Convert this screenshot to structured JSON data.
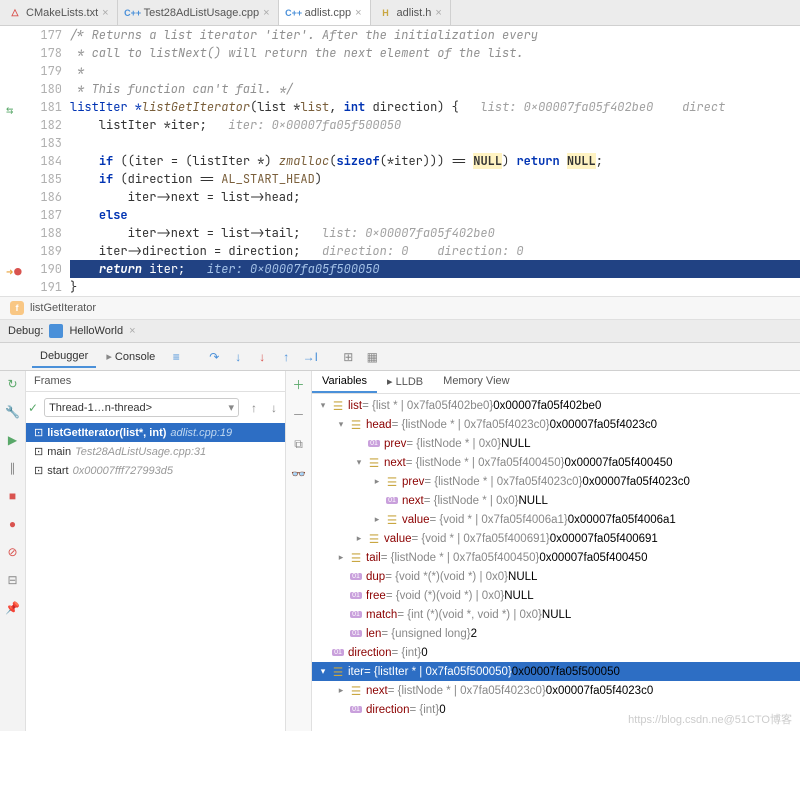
{
  "tabs": [
    {
      "icon": "cmake",
      "label": "CMakeLists.txt",
      "active": false
    },
    {
      "icon": "cpp",
      "label": "Test28AdListUsage.cpp",
      "active": false
    },
    {
      "icon": "cpp",
      "label": "adlist.cpp",
      "active": true
    },
    {
      "icon": "h",
      "label": "adlist.h",
      "active": false
    }
  ],
  "lines": [
    {
      "n": "177",
      "html": "/* Returns a list iterator 'iter'. After the initialization every",
      "cls": "cm"
    },
    {
      "n": "178",
      "html": " * call to listNext() will return the next element of the list.",
      "cls": "cm"
    },
    {
      "n": "179",
      "html": " *",
      "cls": "cm"
    },
    {
      "n": "180",
      "html": " * This function can't fail. */",
      "cls": "cm"
    },
    {
      "n": "181"
    },
    {
      "n": "182"
    },
    {
      "n": "183"
    },
    {
      "n": "184"
    },
    {
      "n": "185"
    },
    {
      "n": "186"
    },
    {
      "n": "187"
    },
    {
      "n": "188"
    },
    {
      "n": "189"
    },
    {
      "n": "190"
    },
    {
      "n": "191"
    }
  ],
  "code": {
    "l181_pre": "listIter *",
    "l181_fn": "listGetIterator",
    "l181_sig1": "(list *",
    "l181_p1": "list",
    "l181_sig2": ", ",
    "l181_int": "int",
    "l181_p2": " direction) {   ",
    "l181_hint": "list: 0x00007fa05f402be0    direct",
    "l182_pre": "    listIter *iter;   ",
    "l182_hint": "iter: 0x00007fa05f500050",
    "l184_if": "if",
    "l184_a": " ((iter = (listIter *) ",
    "l184_fn": "zmalloc",
    "l184_b": "(",
    "l184_sz": "sizeof",
    "l184_c": "(*iter))) == ",
    "l184_n1": "NULL",
    "l184_d": ") ",
    "l184_ret": "return",
    "l184_e": " ",
    "l184_n2": "NULL",
    "l184_f": ";",
    "l185_if": "if",
    "l185_a": " (direction == ",
    "l185_c": "AL_START_HEAD",
    "l185_b": ")",
    "l186": "        iter->next = list->head;",
    "l187": "else",
    "l188_a": "        iter->next = list->tail;   ",
    "l188_hint": "list: 0x00007fa05f402be0",
    "l189_a": "    iter->direction = direction;   ",
    "l189_hint": "direction: 0    direction: 0",
    "l190_a": "    ",
    "l190_ret": "return",
    "l190_b": " iter;   ",
    "l190_hint": "iter: 0x00007fa05f500050",
    "l191": "}"
  },
  "breadcrumb": {
    "fn": "listGetIterator"
  },
  "debug": {
    "title": "Debug:",
    "config": "HelloWorld",
    "tabs": {
      "debugger": "Debugger",
      "console": "Console"
    },
    "panels": {
      "frames": "Frames",
      "variables": "Variables",
      "lldb": "LLDB",
      "memory": "Memory View"
    },
    "thread": "Thread-1…n-thread>",
    "frames": [
      {
        "name": "listGetIterator(list*, int)",
        "loc": "adlist.cpp:19",
        "sel": true
      },
      {
        "name": "main",
        "loc": "Test28AdListUsage.cpp:31"
      },
      {
        "name": "start",
        "loc": "0x00007fff727993d5"
      }
    ],
    "vars": [
      {
        "d": 0,
        "t": "v",
        "o": "obj",
        "nm": "list",
        "tp": " = {list * | 0x7fa05f402be0} ",
        "vv": "0x00007fa05f402be0"
      },
      {
        "d": 1,
        "t": "v",
        "o": "obj",
        "nm": "head",
        "tp": " = {listNode * | 0x7fa05f4023c0} ",
        "vv": "0x00007fa05f4023c0"
      },
      {
        "d": 2,
        "t": "",
        "o": "prim",
        "nm": "prev",
        "tp": " = {listNode * | 0x0} ",
        "vv": "NULL"
      },
      {
        "d": 2,
        "t": "v",
        "o": "obj",
        "nm": "next",
        "tp": " = {listNode * | 0x7fa05f400450} ",
        "vv": "0x00007fa05f400450"
      },
      {
        "d": 3,
        "t": ">",
        "o": "obj",
        "nm": "prev",
        "tp": " = {listNode * | 0x7fa05f4023c0} ",
        "vv": "0x00007fa05f4023c0"
      },
      {
        "d": 3,
        "t": "",
        "o": "prim",
        "nm": "next",
        "tp": " = {listNode * | 0x0} ",
        "vv": "NULL"
      },
      {
        "d": 3,
        "t": ">",
        "o": "obj",
        "nm": "value",
        "tp": " = {void * | 0x7fa05f4006a1} ",
        "vv": "0x00007fa05f4006a1"
      },
      {
        "d": 2,
        "t": ">",
        "o": "obj",
        "nm": "value",
        "tp": " = {void * | 0x7fa05f400691} ",
        "vv": "0x00007fa05f400691"
      },
      {
        "d": 1,
        "t": ">",
        "o": "obj",
        "nm": "tail",
        "tp": " = {listNode * | 0x7fa05f400450} ",
        "vv": "0x00007fa05f400450"
      },
      {
        "d": 1,
        "t": "",
        "o": "prim",
        "nm": "dup",
        "tp": " = {void *(*)(void *) | 0x0} ",
        "vv": "NULL"
      },
      {
        "d": 1,
        "t": "",
        "o": "prim",
        "nm": "free",
        "tp": " = {void (*)(void *) | 0x0} ",
        "vv": "NULL"
      },
      {
        "d": 1,
        "t": "",
        "o": "prim",
        "nm": "match",
        "tp": " = {int (*)(void *, void *) | 0x0} ",
        "vv": "NULL"
      },
      {
        "d": 1,
        "t": "",
        "o": "prim",
        "nm": "len",
        "tp": " = {unsigned long} ",
        "vv": "2"
      },
      {
        "d": 0,
        "t": "",
        "o": "prim",
        "nm": "direction",
        "tp": " = {int} ",
        "vv": "0"
      },
      {
        "d": 0,
        "t": "v",
        "o": "obj",
        "nm": "iter",
        "tp": " = {listIter * | 0x7fa05f500050} ",
        "vv": "0x00007fa05f500050",
        "sel": true
      },
      {
        "d": 1,
        "t": ">",
        "o": "obj",
        "nm": "next",
        "tp": " = {listNode * | 0x7fa05f4023c0} ",
        "vv": "0x00007fa05f4023c0"
      },
      {
        "d": 1,
        "t": "",
        "o": "prim",
        "nm": "direction",
        "tp": " = {int} ",
        "vv": "0"
      }
    ]
  },
  "watermark": "https://blog.csdn.ne@51CTO博客"
}
